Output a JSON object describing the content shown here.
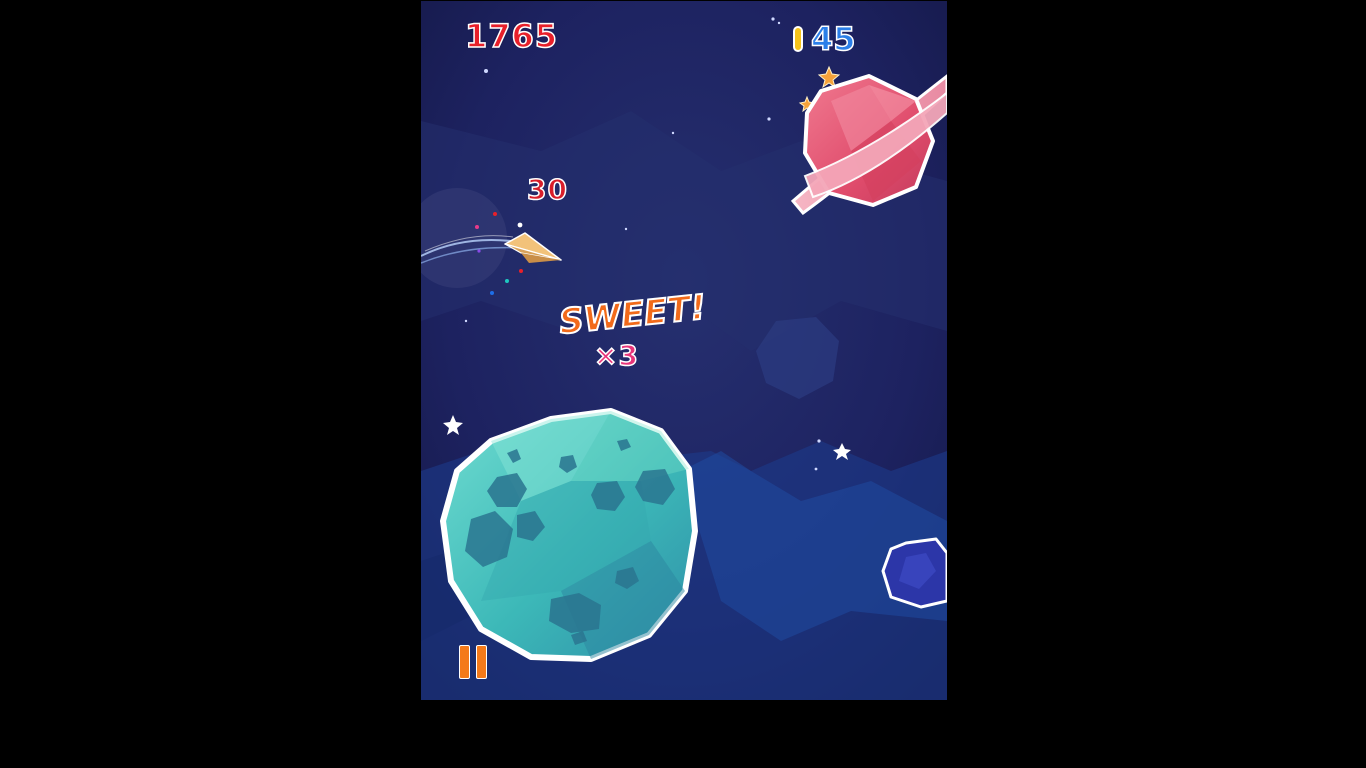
{
  "hud": {
    "score": "1765",
    "gem_count": "45",
    "pause_icon": "pause-icon",
    "gem_icon": "gem-icon"
  },
  "popups": {
    "points": "30",
    "combo_label": "SWEET!",
    "combo_multiplier": "×3"
  },
  "colors": {
    "background": "#1b1f57",
    "score": "#e8202a",
    "gem_count": "#2b7fe8",
    "pause": "#f47a1a",
    "moon": "#46c4c0",
    "ringed_planet": "#e85a78"
  }
}
